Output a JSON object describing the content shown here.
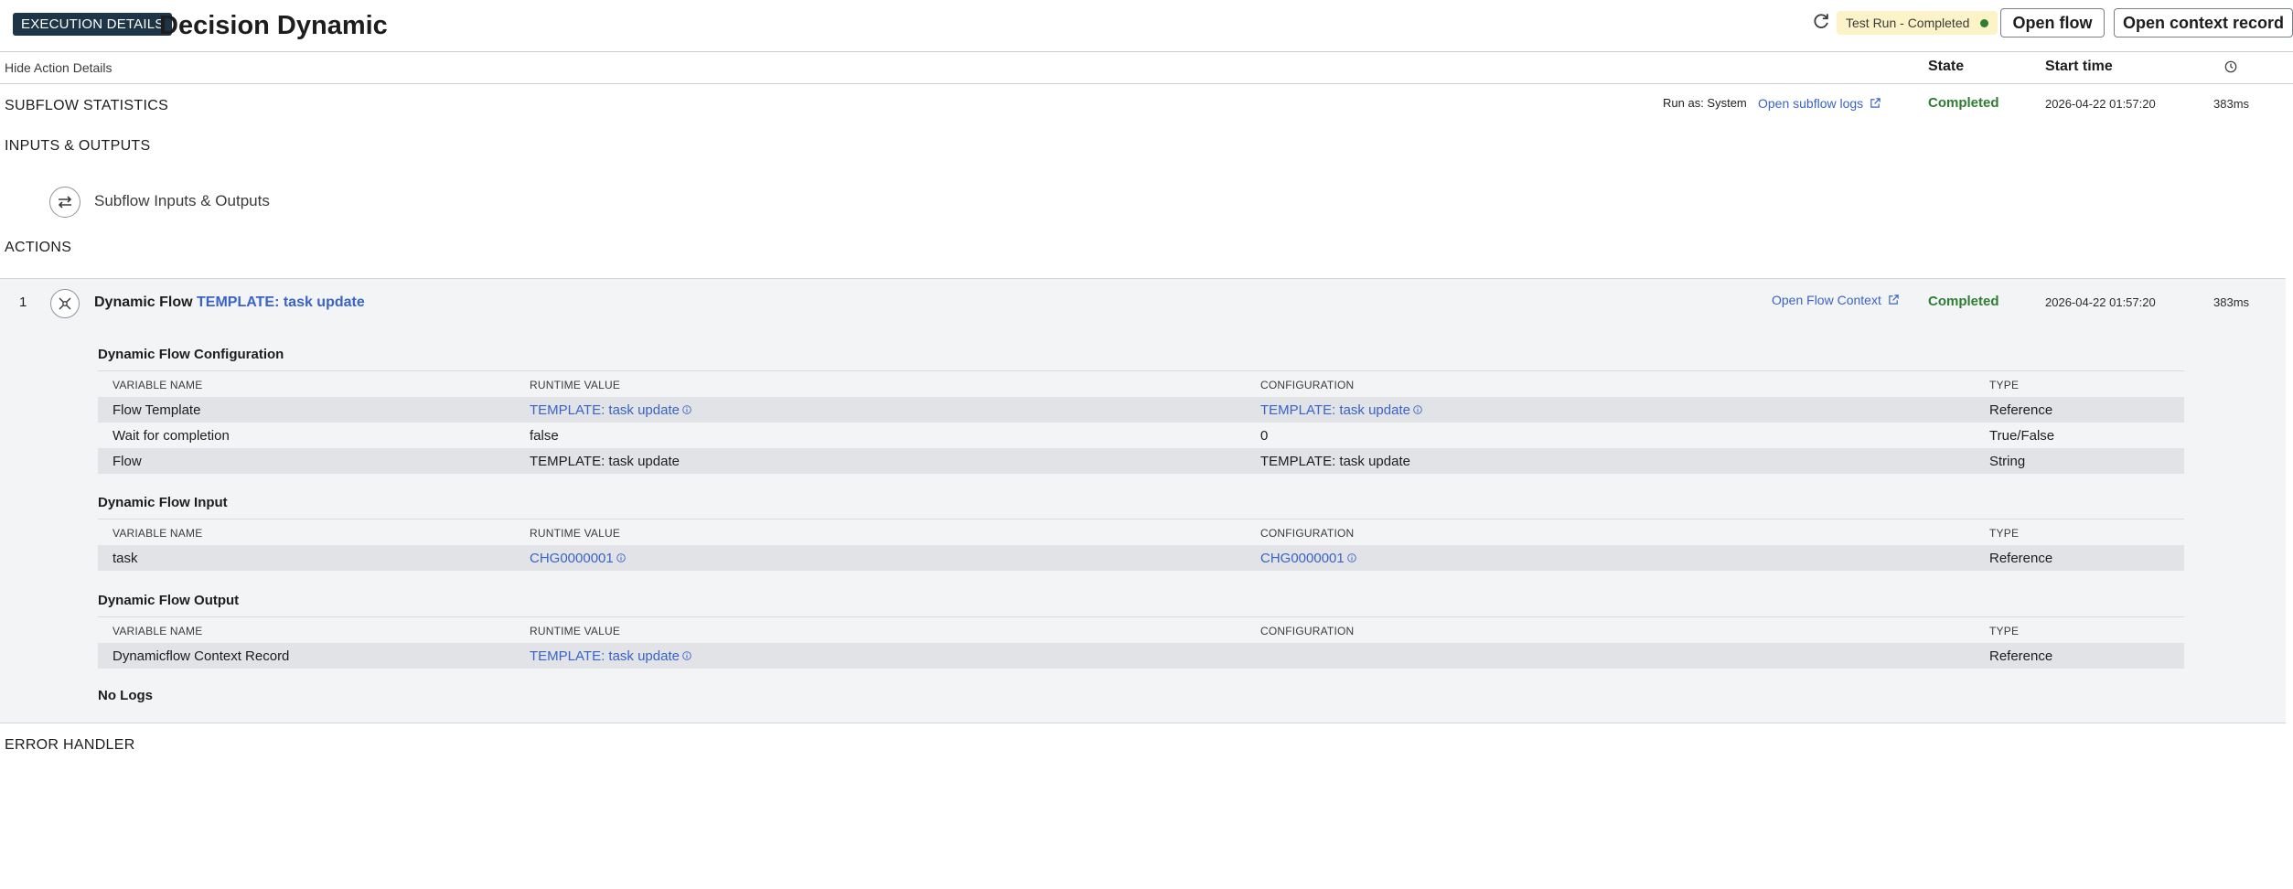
{
  "header": {
    "badge": "EXECUTION DETAILS",
    "title": "Decision Dynamic",
    "status": "Test Run - Completed",
    "open_flow": "Open flow",
    "open_context_record": "Open context record"
  },
  "columns": {
    "hide_action_details": "Hide Action Details",
    "state": "State",
    "start_time": "Start time"
  },
  "subflow": {
    "heading": "SUBFLOW STATISTICS",
    "run_as": "Run as: System",
    "open_logs": "Open subflow logs",
    "state": "Completed",
    "start_time": "2026-04-22 01:57:20",
    "duration": "383ms"
  },
  "inputs_outputs": {
    "heading": "INPUTS & OUTPUTS",
    "item_label": "Subflow Inputs & Outputs"
  },
  "actions": {
    "heading": "ACTIONS",
    "item": {
      "number": "1",
      "title_prefix": "Dynamic Flow",
      "title_link": "TEMPLATE: task update",
      "open_context": "Open Flow Context",
      "state": "Completed",
      "start_time": "2026-04-22 01:57:20",
      "duration": "383ms"
    },
    "table_headers": {
      "variable_name": "VARIABLE NAME",
      "runtime_value": "RUNTIME VALUE",
      "configuration": "CONFIGURATION",
      "type": "TYPE"
    },
    "configuration": {
      "title": "Dynamic Flow Configuration",
      "rows": [
        {
          "name": "Flow Template",
          "runtime": "TEMPLATE: task update",
          "config": "TEMPLATE: task update",
          "type": "Reference"
        },
        {
          "name": "Wait for completion",
          "runtime": "false",
          "config": "0",
          "type": "True/False"
        },
        {
          "name": "Flow",
          "runtime": "TEMPLATE: task update",
          "config": "TEMPLATE: task update",
          "type": "String"
        }
      ]
    },
    "input": {
      "title": "Dynamic Flow Input",
      "rows": [
        {
          "name": "task",
          "runtime": "CHG0000001",
          "config": "CHG0000001",
          "type": "Reference"
        }
      ]
    },
    "output": {
      "title": "Dynamic Flow Output",
      "rows": [
        {
          "name": "Dynamicflow Context Record",
          "runtime": "TEMPLATE: task update",
          "config": "",
          "type": "Reference"
        }
      ]
    },
    "no_logs": "No Logs"
  },
  "error_handler": {
    "heading": "ERROR HANDLER"
  }
}
